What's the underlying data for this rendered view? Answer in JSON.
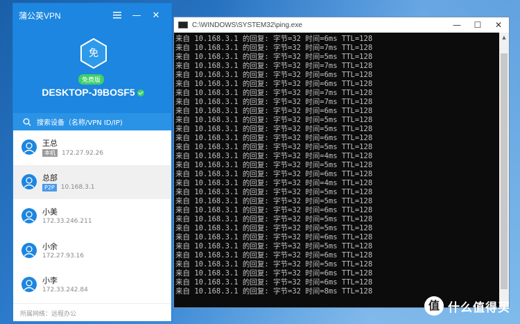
{
  "vpn": {
    "app_title": "蒲公英VPN",
    "menu_icon": "hamburger-icon",
    "minimize_glyph": "—",
    "close_glyph": "✕",
    "avatar_char": "免",
    "plan_badge": "免费版",
    "device_name": "DESKTOP-J9BOSF5",
    "search_placeholder": "搜索设备（名称/VPN ID/IP)",
    "accent": "#1c86e0",
    "devices": [
      {
        "name": "王总",
        "tag": "本机",
        "ip": "172.27.92.26"
      },
      {
        "name": "总部",
        "tag": "P2P",
        "ip": "10.168.3.1"
      },
      {
        "name": "小美",
        "tag": "",
        "ip": "172.33.246.211"
      },
      {
        "name": "小余",
        "tag": "",
        "ip": "172.27.93.16"
      },
      {
        "name": "小李",
        "tag": "",
        "ip": "172.33.242.84"
      }
    ],
    "footer": "所属网络：远程办公"
  },
  "console": {
    "title": "C:\\WINDOWS\\SYSTEM32\\ping.exe",
    "lines": [
      "来自 10.168.3.1 的回复: 字节=32 时间=6ms TTL=128",
      "来自 10.168.3.1 的回复: 字节=32 时间=7ms TTL=128",
      "来自 10.168.3.1 的回复: 字节=32 时间=5ms TTL=128",
      "来自 10.168.3.1 的回复: 字节=32 时间=7ms TTL=128",
      "来自 10.168.3.1 的回复: 字节=32 时间=6ms TTL=128",
      "来自 10.168.3.1 的回复: 字节=32 时间=6ms TTL=128",
      "来自 10.168.3.1 的回复: 字节=32 时间=7ms TTL=128",
      "来自 10.168.3.1 的回复: 字节=32 时间=7ms TTL=128",
      "来自 10.168.3.1 的回复: 字节=32 时间=6ms TTL=128",
      "来自 10.168.3.1 的回复: 字节=32 时间=5ms TTL=128",
      "来自 10.168.3.1 的回复: 字节=32 时间=5ms TTL=128",
      "来自 10.168.3.1 的回复: 字节=32 时间=6ms TTL=128",
      "来自 10.168.3.1 的回复: 字节=32 时间=5ms TTL=128",
      "来自 10.168.3.1 的回复: 字节=32 时间=4ms TTL=128",
      "来自 10.168.3.1 的回复: 字节=32 时间=5ms TTL=128",
      "来自 10.168.3.1 的回复: 字节=32 时间=6ms TTL=128",
      "来自 10.168.3.1 的回复: 字节=32 时间=4ms TTL=128",
      "来自 10.168.3.1 的回复: 字节=32 时间=5ms TTL=128",
      "来自 10.168.3.1 的回复: 字节=32 时间=5ms TTL=128",
      "来自 10.168.3.1 的回复: 字节=32 时间=6ms TTL=128",
      "来自 10.168.3.1 的回复: 字节=32 时间=5ms TTL=128",
      "来自 10.168.3.1 的回复: 字节=32 时间=5ms TTL=128",
      "来自 10.168.3.1 的回复: 字节=32 时间=6ms TTL=128",
      "来自 10.168.3.1 的回复: 字节=32 时间=5ms TTL=128",
      "来自 10.168.3.1 的回复: 字节=32 时间=6ms TTL=128",
      "来自 10.168.3.1 的回复: 字节=32 时间=5ms TTL=128",
      "来自 10.168.3.1 的回复: 字节=32 时间=6ms TTL=128",
      "来自 10.168.3.1 的回复: 字节=32 时间=6ms TTL=128",
      "来自 10.168.3.1 的回复: 字节=32 时间=8ms TTL=128"
    ],
    "minimize_glyph": "—",
    "maximize_glyph": "☐",
    "close_glyph": "✕"
  },
  "watermark": {
    "logo_char": "值",
    "text": "什么值得买"
  }
}
